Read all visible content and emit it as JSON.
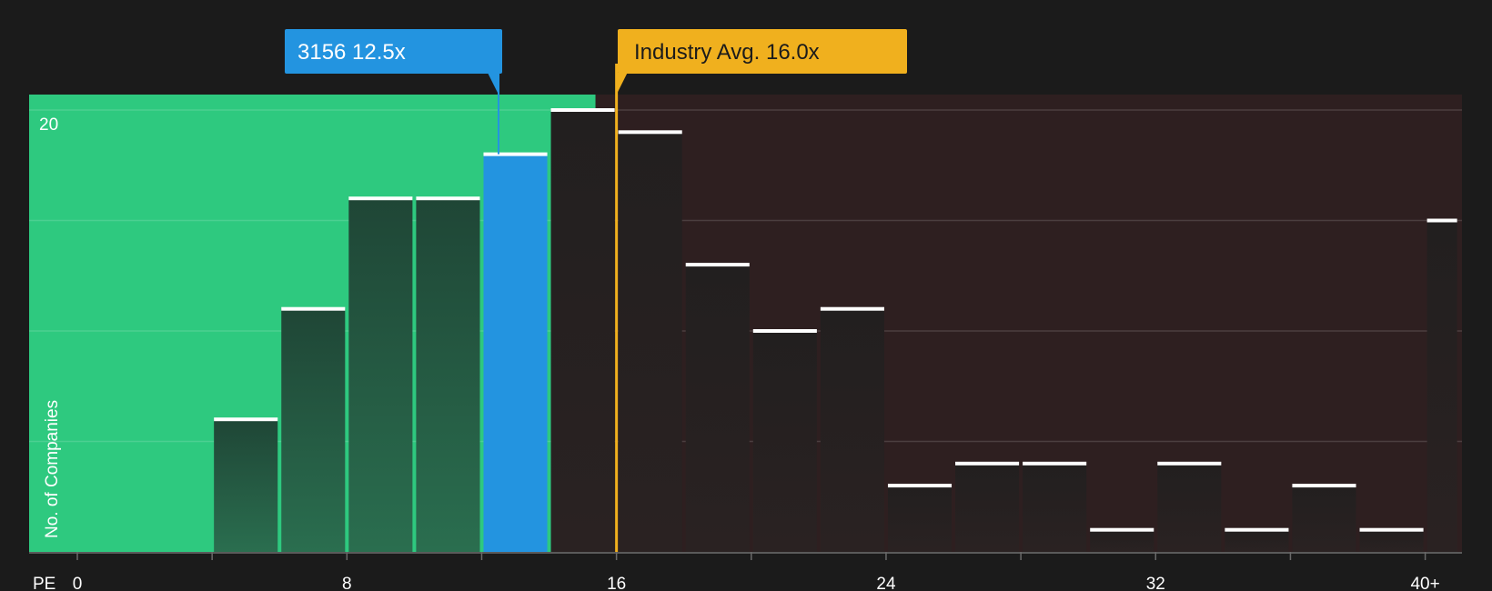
{
  "chart_data": {
    "type": "bar",
    "xlabel": "PE",
    "ylabel": "No. of Companies",
    "ylim": [
      0,
      20.7
    ],
    "ytick_labels": [
      "20"
    ],
    "xtick_labels": [
      "0",
      "8",
      "16",
      "24",
      "32",
      "40+"
    ],
    "bins": [
      {
        "x0": 0,
        "x1": 2,
        "value": 0
      },
      {
        "x0": 2,
        "x1": 4,
        "value": 0
      },
      {
        "x0": 4,
        "x1": 6,
        "value": 6
      },
      {
        "x0": 6,
        "x1": 8,
        "value": 11
      },
      {
        "x0": 8,
        "x1": 10,
        "value": 16
      },
      {
        "x0": 10,
        "x1": 12,
        "value": 16
      },
      {
        "x0": 12,
        "x1": 14,
        "value": 18
      },
      {
        "x0": 14,
        "x1": 16,
        "value": 20
      },
      {
        "x0": 16,
        "x1": 18,
        "value": 19
      },
      {
        "x0": 18,
        "x1": 20,
        "value": 13
      },
      {
        "x0": 20,
        "x1": 22,
        "value": 10
      },
      {
        "x0": 22,
        "x1": 24,
        "value": 11
      },
      {
        "x0": 24,
        "x1": 26,
        "value": 3
      },
      {
        "x0": 26,
        "x1": 28,
        "value": 4
      },
      {
        "x0": 28,
        "x1": 30,
        "value": 4
      },
      {
        "x0": 30,
        "x1": 32,
        "value": 1
      },
      {
        "x0": 32,
        "x1": 34,
        "value": 4
      },
      {
        "x0": 34,
        "x1": 36,
        "value": 1
      },
      {
        "x0": 36,
        "x1": 38,
        "value": 3
      },
      {
        "x0": 38,
        "x1": 40,
        "value": 1
      },
      {
        "x0": 40,
        "x1": 41,
        "value": 15
      }
    ],
    "company": {
      "label": "3156 12.5x",
      "pe": 12.5
    },
    "industry": {
      "label": "Industry Avg. 16.0x",
      "pe": 16.0
    },
    "colors": {
      "background": "#1b1b1b",
      "undervalued_region": "#2ec97f",
      "overvalued_region": "#2e1f20",
      "bar_green_region": "#1f4a38",
      "bar_red_region": "#242020",
      "company_bar": "#2394e0",
      "industry_line": "#f0b01e",
      "cap": "#ffffff",
      "grid": "#ffffff"
    }
  }
}
